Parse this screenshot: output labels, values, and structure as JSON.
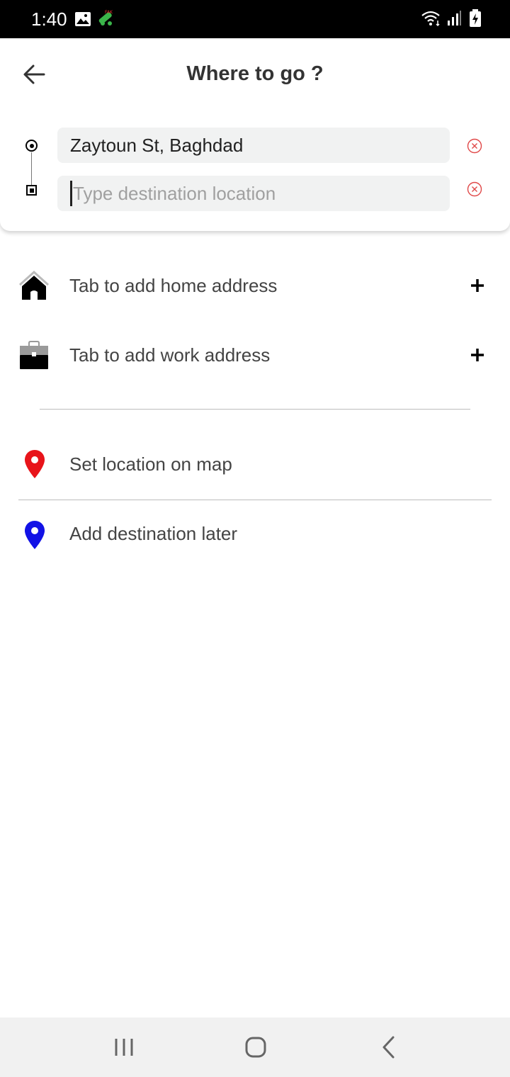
{
  "status_bar": {
    "time": "1:40",
    "icons": [
      "image-icon",
      "app-notification-icon",
      "wifi-icon",
      "signal-icon",
      "battery-charging-icon"
    ]
  },
  "header": {
    "title": "Where to go ?",
    "back_icon": "arrow-left-icon"
  },
  "route": {
    "origin_value": "Zaytoun St, Baghdad",
    "destination_value": "",
    "destination_placeholder": "Type destination location",
    "clear_icon": "circle-x-icon"
  },
  "saved_places": [
    {
      "label": "Tab to add home address",
      "icon": "home-icon",
      "action_icon": "plus-icon"
    },
    {
      "label": "Tab to add work address",
      "icon": "briefcase-icon",
      "action_icon": "plus-icon"
    }
  ],
  "options": [
    {
      "label": "Set location on map",
      "icon": "map-pin-icon",
      "color": "#e8141a"
    },
    {
      "label": "Add destination later",
      "icon": "map-pin-icon",
      "color": "#1212e6"
    }
  ],
  "nav_bar": {
    "icons": [
      "recent-apps-icon",
      "home-button-icon",
      "back-icon"
    ]
  }
}
